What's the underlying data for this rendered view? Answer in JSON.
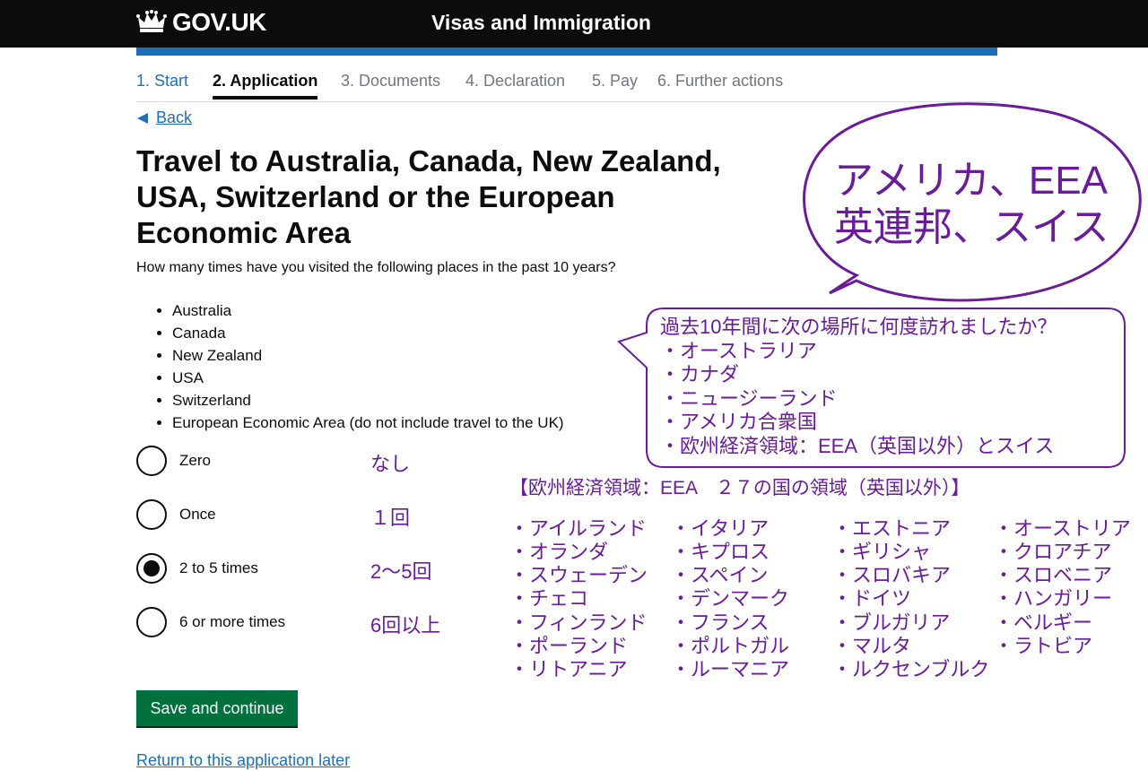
{
  "header": {
    "logo_text": "GOV.UK",
    "service_name": "Visas and Immigration"
  },
  "colors": {
    "header_bg": "#0b0c0c",
    "accent_blue": "#1d70b8",
    "button_green": "#00703c",
    "annotation_purple": "#6a1b9a"
  },
  "steps": [
    "1. Start",
    "2. Application",
    "3. Documents",
    "4. Declaration",
    "5. Pay",
    "6. Further actions"
  ],
  "back_label": "Back",
  "page": {
    "title": "Travel to Australia, Canada, New Zealand, USA, Switzerland or the European Economic Area",
    "hint": "How many times have you visited the following places in the past 10 years?",
    "places": [
      "Australia",
      "Canada",
      "New Zealand",
      "USA",
      "Switzerland",
      "European Economic Area (do not include travel to the UK)"
    ]
  },
  "options": [
    {
      "label": "Zero",
      "jp": "なし"
    },
    {
      "label": "Once",
      "jp": "１回"
    },
    {
      "label": "2 to 5 times",
      "jp": "2～5回"
    },
    {
      "label": "6 or more times",
      "jp": "6回以上"
    }
  ],
  "selected_option": "2 to 5 times",
  "buttons": {
    "save": "Save and continue",
    "return_later": "Return to this application later"
  },
  "annotations": {
    "bubble1_lines": [
      "アメリカ、EEA",
      "英連邦、スイス"
    ],
    "bubble2_lines": [
      "過去10年間に次の場所に何度訪れましたか？",
      "・オーストラリア",
      "・カナダ",
      "・ニュージーランド",
      "・アメリカ合衆国",
      "・欧州経済領域：EEA（英国以外）とスイス"
    ],
    "eea_title": "【欧州経済領域：EEA　２７の国の領域（英国以外）】",
    "eea_columns": [
      [
        "・アイルランド",
        "・オランダ",
        "・スウェーデン",
        "・チェコ",
        "・フィンランド",
        "・ポーランド",
        "・リトアニア"
      ],
      [
        "・イタリア",
        "・キプロス",
        "・スペイン",
        "・デンマーク",
        "・フランス",
        "・ポルトガル",
        "・ルーマニア"
      ],
      [
        "・エストニア",
        "・ギリシャ",
        "・スロバキア",
        "・ドイツ",
        "・ブルガリア",
        "・マルタ",
        "・ルクセンブルク"
      ],
      [
        "・オーストリア",
        "・クロアチア",
        "・スロベニア",
        "・ハンガリー",
        "・ベルギー",
        "・ラトビア"
      ]
    ]
  }
}
